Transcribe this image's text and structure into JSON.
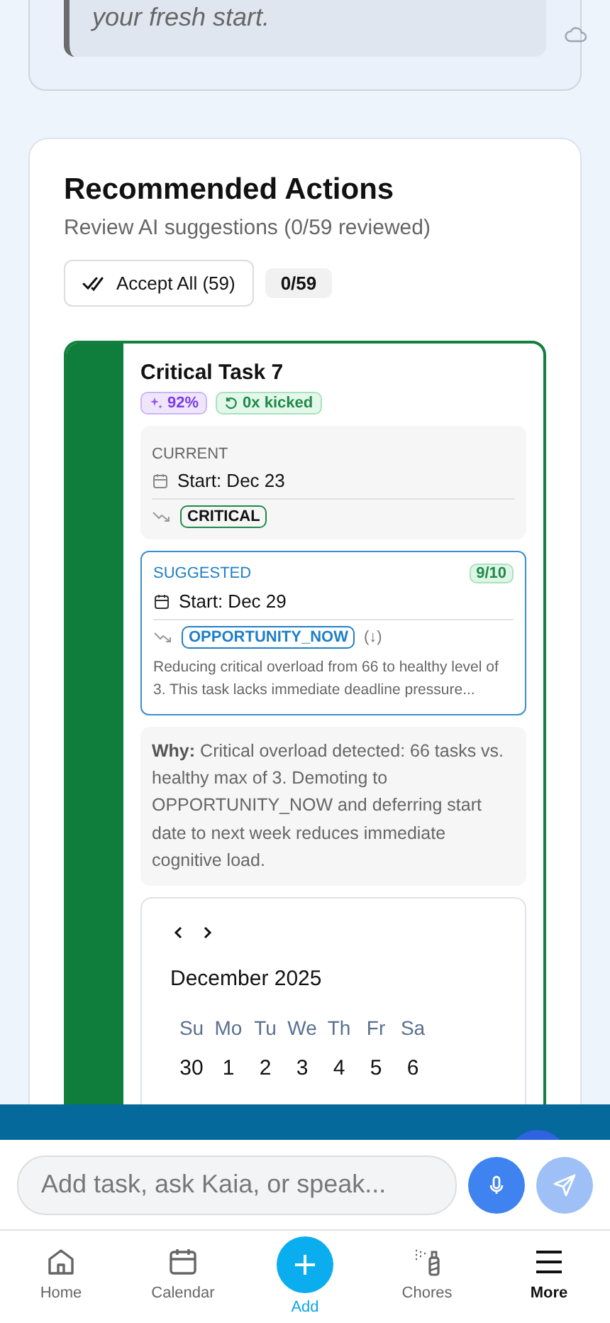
{
  "top_card": {
    "quote": "your fresh start."
  },
  "recommended": {
    "title": "Recommended Actions",
    "subtitle": "Review AI suggestions (0/59 reviewed)",
    "accept_button": "Accept All (59)",
    "progress": "0/59"
  },
  "task": {
    "title": "Critical Task 7",
    "badges": [
      {
        "kind": "confidence",
        "text": "92%"
      },
      {
        "kind": "kicked",
        "text": "0x kicked"
      }
    ],
    "current": {
      "label": "CURRENT",
      "start": "Start: Dec 23",
      "priority": "CRITICAL"
    },
    "suggested": {
      "label": "SUGGESTED",
      "score": "9/10",
      "start": "Start: Dec 29",
      "priority": "OPPORTUNITY_NOW",
      "change": "(↓)",
      "reason": "Reducing critical overload from 66 to healthy level of 3. This task lacks immediate deadline pressure..."
    },
    "why": "**Why:** Critical overload detected: 66 tasks vs. healthy max of 3. Demoting to OPPORTUNITY_NOW and deferring start date to next week reduces immediate cognitive load.",
    "calendar": {
      "month": "December 2025",
      "weekdays": [
        "Su",
        "Mo",
        "Tu",
        "We",
        "Th",
        "Fr",
        "Sa"
      ],
      "days": [
        "30",
        "1",
        "2",
        "3",
        "4",
        "5",
        "6"
      ]
    }
  },
  "chat_input": {
    "placeholder": "Add task, ask Kaia, or speak..."
  },
  "nav": [
    {
      "kind": "home",
      "label": "Home",
      "selected": false
    },
    {
      "kind": "calendar",
      "label": "Calendar",
      "selected": false
    },
    {
      "kind": "add",
      "label": "Add",
      "selected": false
    },
    {
      "kind": "chores",
      "label": "Chores",
      "selected": false
    },
    {
      "kind": "more",
      "label": "More",
      "selected": true
    }
  ]
}
